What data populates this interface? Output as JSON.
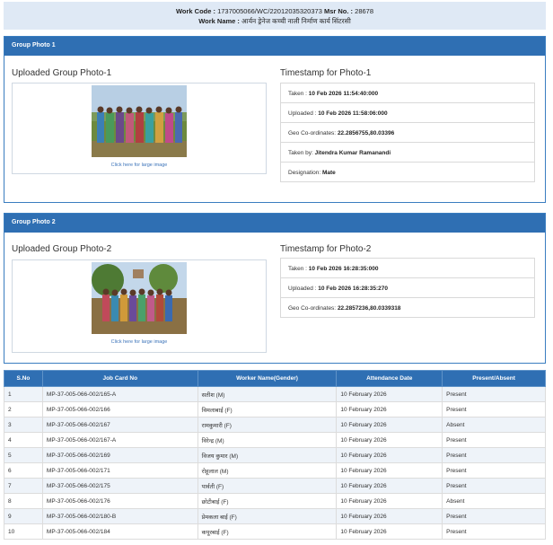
{
  "header": {
    "work_code_label": "Work Code :",
    "work_code": "1737005066/WC/22012035320373",
    "msr_label": "Msr No. :",
    "msr_no": "28678",
    "work_name_label": "Work Name :",
    "work_name": "आर्यन ड्रेनेज कच्ची नाली निर्माण कार्य सिंटरसी"
  },
  "group1": {
    "heading": "Group Photo 1",
    "uploaded_title": "Uploaded Group Photo-1",
    "link": "Click here for large image",
    "timestamp_title": "Timestamp for Photo-1",
    "rows": [
      {
        "label": "Taken :",
        "value": "10 Feb 2026 11:54:40:000"
      },
      {
        "label": "Uploaded :",
        "value": "10 Feb 2026 11:58:06:000"
      },
      {
        "label": "Geo Co-ordinates:",
        "value": "22.2856755,80.03396"
      },
      {
        "label": "Taken by:",
        "value": "Jitendra Kumar Ramanandi"
      },
      {
        "label": "Designation:",
        "value": "Mate"
      }
    ]
  },
  "group2": {
    "heading": "Group Photo 2",
    "uploaded_title": "Uploaded Group Photo-2",
    "link": "Click here for large image",
    "timestamp_title": "Timestamp for Photo-2",
    "rows": [
      {
        "label": "Taken :",
        "value": "10 Feb 2026 16:28:35:000"
      },
      {
        "label": "Uploaded :",
        "value": "10 Feb 2026 16:28:35:270"
      },
      {
        "label": "Geo Co-ordinates:",
        "value": "22.2857236,80.0339318"
      }
    ]
  },
  "table": {
    "headers": [
      "S.No",
      "Job Card No",
      "Worker Name(Gender)",
      "Attendance Date",
      "Present/Absent"
    ],
    "rows": [
      [
        "1",
        "MP-37-005-066-002/165-A",
        "सतीश (M)",
        "10 February 2026",
        "Present"
      ],
      [
        "2",
        "MP-37-005-066-002/166",
        "विमलाबाई (F)",
        "10 February 2026",
        "Present"
      ],
      [
        "3",
        "MP-37-005-066-002/167",
        "रामकुमारी (F)",
        "10 February 2026",
        "Absent"
      ],
      [
        "4",
        "MP-37-005-066-002/167-A",
        "विरेन्द्र (M)",
        "10 February 2026",
        "Present"
      ],
      [
        "5",
        "MP-37-005-066-002/169",
        "विजय कुमार (M)",
        "10 February 2026",
        "Present"
      ],
      [
        "6",
        "MP-37-005-066-002/171",
        "रोहूलाल (M)",
        "10 February 2026",
        "Present"
      ],
      [
        "7",
        "MP-37-005-066-002/175",
        "पार्वती (F)",
        "10 February 2026",
        "Present"
      ],
      [
        "8",
        "MP-37-005-066-002/176",
        "छोटीबाई (F)",
        "10 February 2026",
        "Absent"
      ],
      [
        "9",
        "MP-37-005-066-002/180-B",
        "प्रेमकला बाई (F)",
        "10 February 2026",
        "Present"
      ],
      [
        "10",
        "MP-37-005-066-002/184",
        "कपूरबाई (F)",
        "10 February 2026",
        "Present"
      ]
    ]
  }
}
